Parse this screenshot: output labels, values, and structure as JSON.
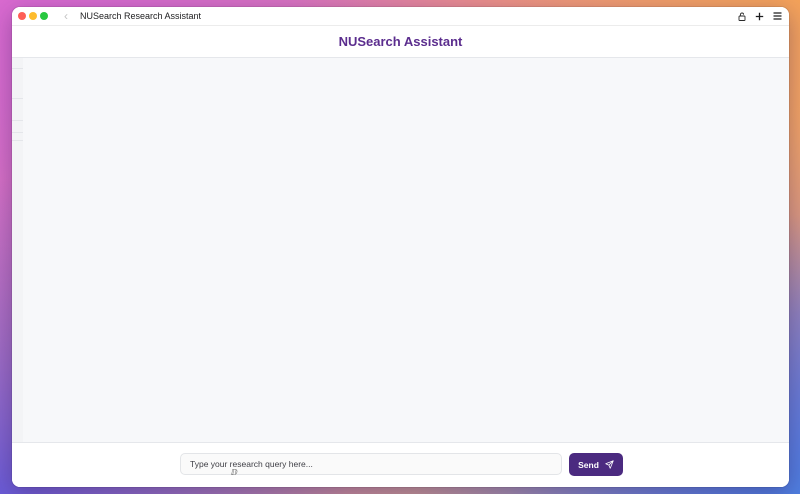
{
  "window": {
    "title": "NUSearch Research Assistant",
    "back_icon": "chevron-left-icon",
    "toolbar_icons": [
      "lock-icon",
      "plus-icon",
      "menu-icon"
    ]
  },
  "header": {
    "title": "NUSearch Assistant"
  },
  "composer": {
    "placeholder": "Type your research query here...",
    "value": "",
    "send_label": "Send",
    "send_icon": "paper-plane-icon"
  },
  "colors": {
    "accent": "#5b2d8e",
    "send_button": "#4b2a80",
    "chat_background": "#f7f8fa"
  }
}
